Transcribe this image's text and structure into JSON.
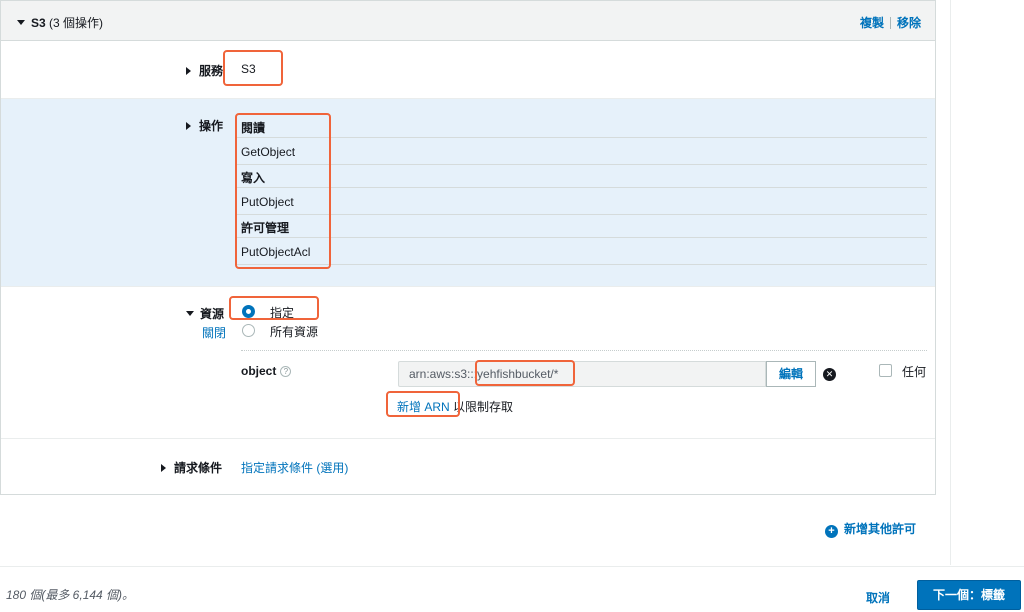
{
  "panel": {
    "title": "S3",
    "title_sub": "(3 個操作)",
    "copy_label": "複製",
    "remove_label": "移除"
  },
  "service": {
    "label": "服務",
    "value": "S3"
  },
  "actions": {
    "label": "操作",
    "groups": [
      {
        "name": "閱讀",
        "item": "GetObject"
      },
      {
        "name": "寫入",
        "item": "PutObject"
      },
      {
        "name": "許可管理",
        "item": "PutObjectAcl"
      }
    ]
  },
  "resources": {
    "label": "資源",
    "close_label": "關閉",
    "option_specific": "指定",
    "option_all": "所有資源",
    "selected": "指定",
    "object_label": "object",
    "arn_value": "arn:aws:s3:::yehfishbucket/*",
    "edit_label": "編輯",
    "any_label": "任何",
    "add_arn_label": "新增 ARN",
    "add_arn_suffix": "以限制存取"
  },
  "conditions": {
    "label": "請求條件",
    "link": "指定請求條件 (選用)"
  },
  "add_permission_label": "新增其他許可",
  "footer": {
    "count_text": "180 個(最多 6,144 個)。",
    "cancel_label": "取消",
    "next_label": "下一個：標籤"
  },
  "colors": {
    "accent": "#0073bb",
    "highlight": "#f0643a",
    "selected_row_bg": "#e6f1fa"
  }
}
